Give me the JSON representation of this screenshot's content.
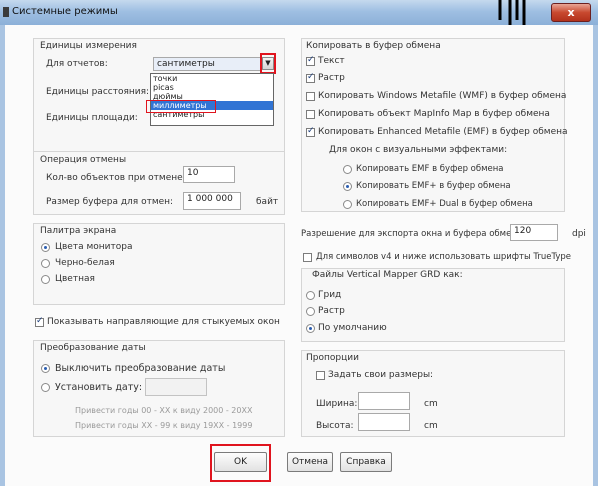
{
  "window": {
    "title": "Системные режимы",
    "close_label": "x"
  },
  "units": {
    "group_title": "Единицы измерения",
    "reports_label": "Для отчетов:",
    "reports_value": "сантиметры",
    "distance_label": "Единицы расстояния:",
    "area_label": "Единицы площади:",
    "dropdown_options": [
      "точки",
      "picas",
      "дюймы",
      "миллиметры",
      "сантиметры"
    ],
    "dropdown_selected_index": 3
  },
  "undo": {
    "group_title": "Операция отмены",
    "count_label": "Кол-во объектов при отмене:",
    "count_value": "10",
    "buffer_label": "Размер буфера для отмен:",
    "buffer_value": "1 000 000",
    "buffer_unit": "байт"
  },
  "palette": {
    "group_title": "Палитра экрана",
    "options": [
      {
        "label": "Цвета монитора",
        "checked": true
      },
      {
        "label": "Черно-белая",
        "checked": false
      },
      {
        "label": "Цветная",
        "checked": false
      }
    ]
  },
  "snap_guides": {
    "label": "Показывать направляющие для стыкуемых окон",
    "checked": true
  },
  "date_conversion": {
    "group_title": "Преобразование даты",
    "off_label": "Выключить преобразование даты",
    "set_label": "Установить дату:",
    "hint1": "Привести годы 00 - XX к виду 2000 - 20XX",
    "hint2": "Привести годы XX - 99 к виду 19XX - 1999"
  },
  "clipboard": {
    "group_title": "Копировать в буфер обмена",
    "items": [
      {
        "label": "Текст",
        "checked": true
      },
      {
        "label": "Растр",
        "checked": true
      },
      {
        "label": "Копировать Windows Metafile (WMF) в буфер обмена",
        "checked": false
      },
      {
        "label": "Копировать объект MapInfo Map в буфер обмена",
        "checked": false
      },
      {
        "label": "Копировать Enhanced Metafile (EMF) в буфер обмена",
        "checked": true
      }
    ],
    "effects_label": "Для окон с визуальными эффектами:",
    "effects": [
      {
        "label": "Копировать EMF в буфер обмена",
        "checked": false
      },
      {
        "label": "Копировать EMF+ в буфер обмена",
        "checked": true
      },
      {
        "label": "Копировать EMF+ Dual в буфер обмена",
        "checked": false
      }
    ]
  },
  "export": {
    "label": "Разрешение для экспорта окна и буфера обмена:",
    "value": "120",
    "unit": "dpi"
  },
  "truetype": {
    "label": "Для символов v4 и ниже использовать шрифты TrueType",
    "checked": false
  },
  "grd": {
    "group_title": "Файлы Vertical Mapper GRD как:",
    "options": [
      {
        "label": "Грид",
        "checked": false
      },
      {
        "label": "Растр",
        "checked": false
      },
      {
        "label": "По умолчанию",
        "checked": true
      }
    ]
  },
  "proportions": {
    "group_title": "Пропорции",
    "custom_label": "Задать свои размеры:",
    "width_label": "Ширина:",
    "height_label": "Высота:",
    "unit": "cm"
  },
  "buttons": {
    "ok": "OK",
    "cancel": "Отмена",
    "help": "Справка"
  }
}
